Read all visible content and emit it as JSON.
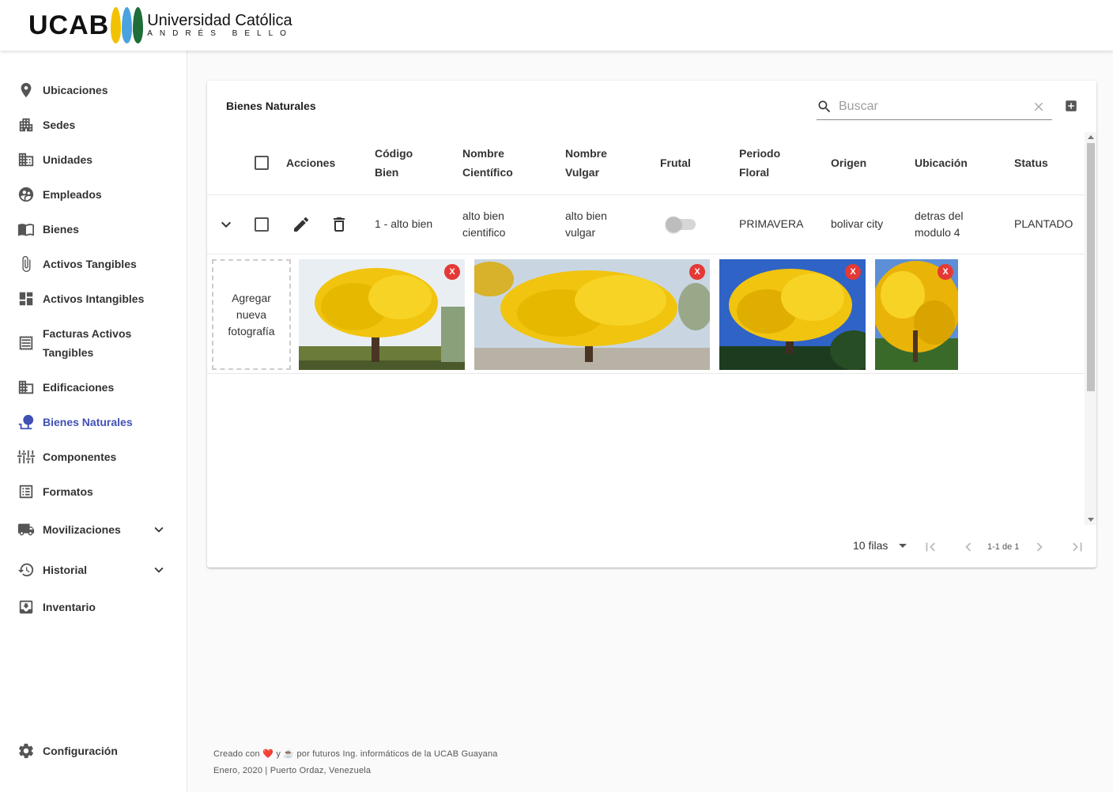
{
  "header": {
    "logo_ucab": "UCAB",
    "logo_university": "Universidad Católica",
    "logo_subtitle": "ANDRÉS BELLO",
    "logo_drop_colors": [
      "#f2c200",
      "#4aa3df",
      "#1f6e3a"
    ]
  },
  "sidebar": {
    "items": [
      {
        "label": "Ubicaciones",
        "icon": "location-pin-icon"
      },
      {
        "label": "Sedes",
        "icon": "buildings-icon"
      },
      {
        "label": "Unidades",
        "icon": "apartment-icon"
      },
      {
        "label": "Empleados",
        "icon": "group-icon"
      },
      {
        "label": "Bienes",
        "icon": "book-icon"
      },
      {
        "label": "Activos Tangibles",
        "icon": "paperclip-icon"
      },
      {
        "label": "Activos Intangibles",
        "icon": "dashboard-icon"
      },
      {
        "label": "Facturas Activos Tangibles",
        "icon": "receipt-icon"
      },
      {
        "label": "Edificaciones",
        "icon": "building-icon"
      },
      {
        "label": "Bienes Naturales",
        "icon": "tree-icon",
        "active": true
      },
      {
        "label": "Componentes",
        "icon": "tune-icon"
      },
      {
        "label": "Formatos",
        "icon": "list-icon"
      },
      {
        "label": "Movilizaciones",
        "icon": "truck-icon",
        "expandable": true
      },
      {
        "label": "Historial",
        "icon": "history-icon",
        "expandable": true
      },
      {
        "label": "Inventario",
        "icon": "inventory-icon"
      }
    ],
    "settings_label": "Configuración"
  },
  "card": {
    "title": "Bienes Naturales",
    "search_placeholder": "Buscar",
    "columns": {
      "acciones": "Acciones",
      "codigo_1": "Código",
      "codigo_2": "Bien",
      "cientifico_1": "Nombre",
      "cientifico_2": "Científico",
      "vulgar_1": "Nombre",
      "vulgar_2": "Vulgar",
      "frutal": "Frutal",
      "periodo_1": "Periodo",
      "periodo_2": "Floral",
      "origen": "Origen",
      "ubicacion": "Ubicación",
      "status": "Status"
    },
    "row": {
      "codigo": "1 - alto bien",
      "cientifico_1": "alto bien",
      "cientifico_2": "cientifico",
      "vulgar_1": "alto bien",
      "vulgar_2": "vulgar",
      "frutal": false,
      "periodo": "PRIMAVERA",
      "origen": "bolivar city",
      "ubicacion_1": "detras del",
      "ubicacion_2": "modulo 4",
      "status": "PLANTADO"
    },
    "add_photo_label": "Agregar nueva fotografía",
    "delete_photo_label": "X",
    "accent_yellow": "#f1c40f",
    "delete_color": "#e53935"
  },
  "pagination": {
    "rows_label": "10 filas",
    "range": "1-1 de 1"
  },
  "footer": {
    "line1_a": "Creado con",
    "heart": "❤️",
    "line1_b": "y",
    "coffee": "☕",
    "line1_c": "por futuros Ing. informáticos de la UCAB Guayana",
    "line2": "Enero, 2020 | Puerto Ordaz, Venezuela"
  }
}
